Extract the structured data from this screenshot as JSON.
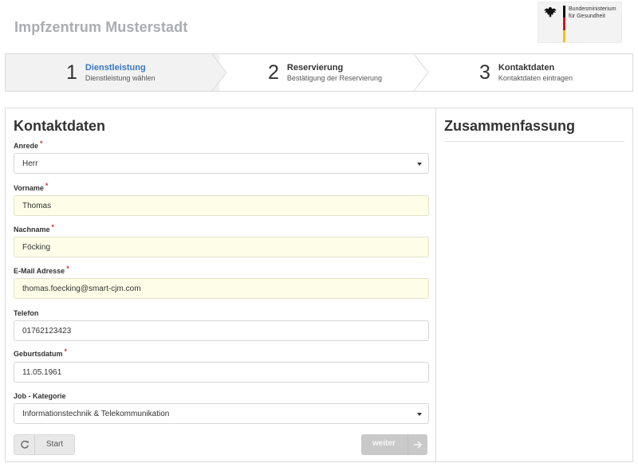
{
  "app_title": "Impfzentrum Musterstadt",
  "logo": {
    "line1": "Bundesministerium",
    "line2": "für Gesundheit",
    "icon": "federal-eagle-icon"
  },
  "steps": [
    {
      "number": "1",
      "title": "Dienstleistung",
      "subtitle": "Dienstleistung wählen",
      "active": true
    },
    {
      "number": "2",
      "title": "Reservierung",
      "subtitle": "Bestätigung der Reservierung",
      "active": false
    },
    {
      "number": "3",
      "title": "Kontaktdaten",
      "subtitle": "Kontaktdaten eintragen",
      "active": false
    }
  ],
  "form": {
    "title": "Kontaktdaten",
    "required_marker": "*",
    "fields": {
      "anrede": {
        "label": "Anrede",
        "value": "Herr",
        "required": true
      },
      "vorname": {
        "label": "Vorname",
        "value": "Thomas",
        "required": true
      },
      "nachname": {
        "label": "Nachname",
        "value": "Föcking",
        "required": true
      },
      "email": {
        "label": "E-Mail Adresse",
        "value": "thomas.foecking@smart-cjm.com",
        "required": true
      },
      "telefon": {
        "label": "Telefon",
        "value": "01762123423",
        "required": false
      },
      "geburtsdatum": {
        "label": "Geburtsdatum",
        "value": "11.05.1961",
        "required": true
      },
      "job": {
        "label": "Job - Kategorie",
        "value": "Informationstechnik & Telekommunikation",
        "required": false
      }
    },
    "buttons": {
      "start": {
        "label": "Start",
        "icon": "refresh-icon"
      },
      "next": {
        "label": "weiter",
        "icon": "arrow-right-icon"
      }
    }
  },
  "summary": {
    "title": "Zusammenfassung"
  },
  "colors": {
    "active_step": "#3a78c4",
    "required": "#d9383a",
    "filled_field": "#fdfde8"
  }
}
